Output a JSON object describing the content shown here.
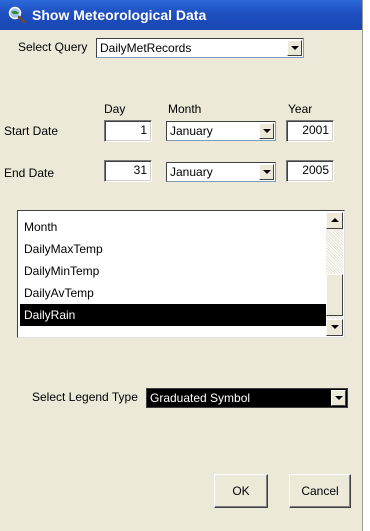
{
  "window": {
    "title": "Show Meteorological Data"
  },
  "query": {
    "label": "Select Query",
    "value": "DailyMetRecords"
  },
  "date_headers": {
    "day": "Day",
    "month": "Month",
    "year": "Year"
  },
  "start_date": {
    "label": "Start Date",
    "day": "1",
    "month": "January",
    "year": "2001"
  },
  "end_date": {
    "label": "End Date",
    "day": "31",
    "month": "January",
    "year": "2005"
  },
  "field_list": {
    "items": [
      "Month",
      "DailyMaxTemp",
      "DailyMinTemp",
      "DailyAvTemp",
      "DailyRain"
    ],
    "selected": "DailyRain"
  },
  "legend": {
    "label": "Select Legend Type",
    "value": "Graduated Symbol"
  },
  "buttons": {
    "ok": "OK",
    "cancel": "Cancel"
  }
}
